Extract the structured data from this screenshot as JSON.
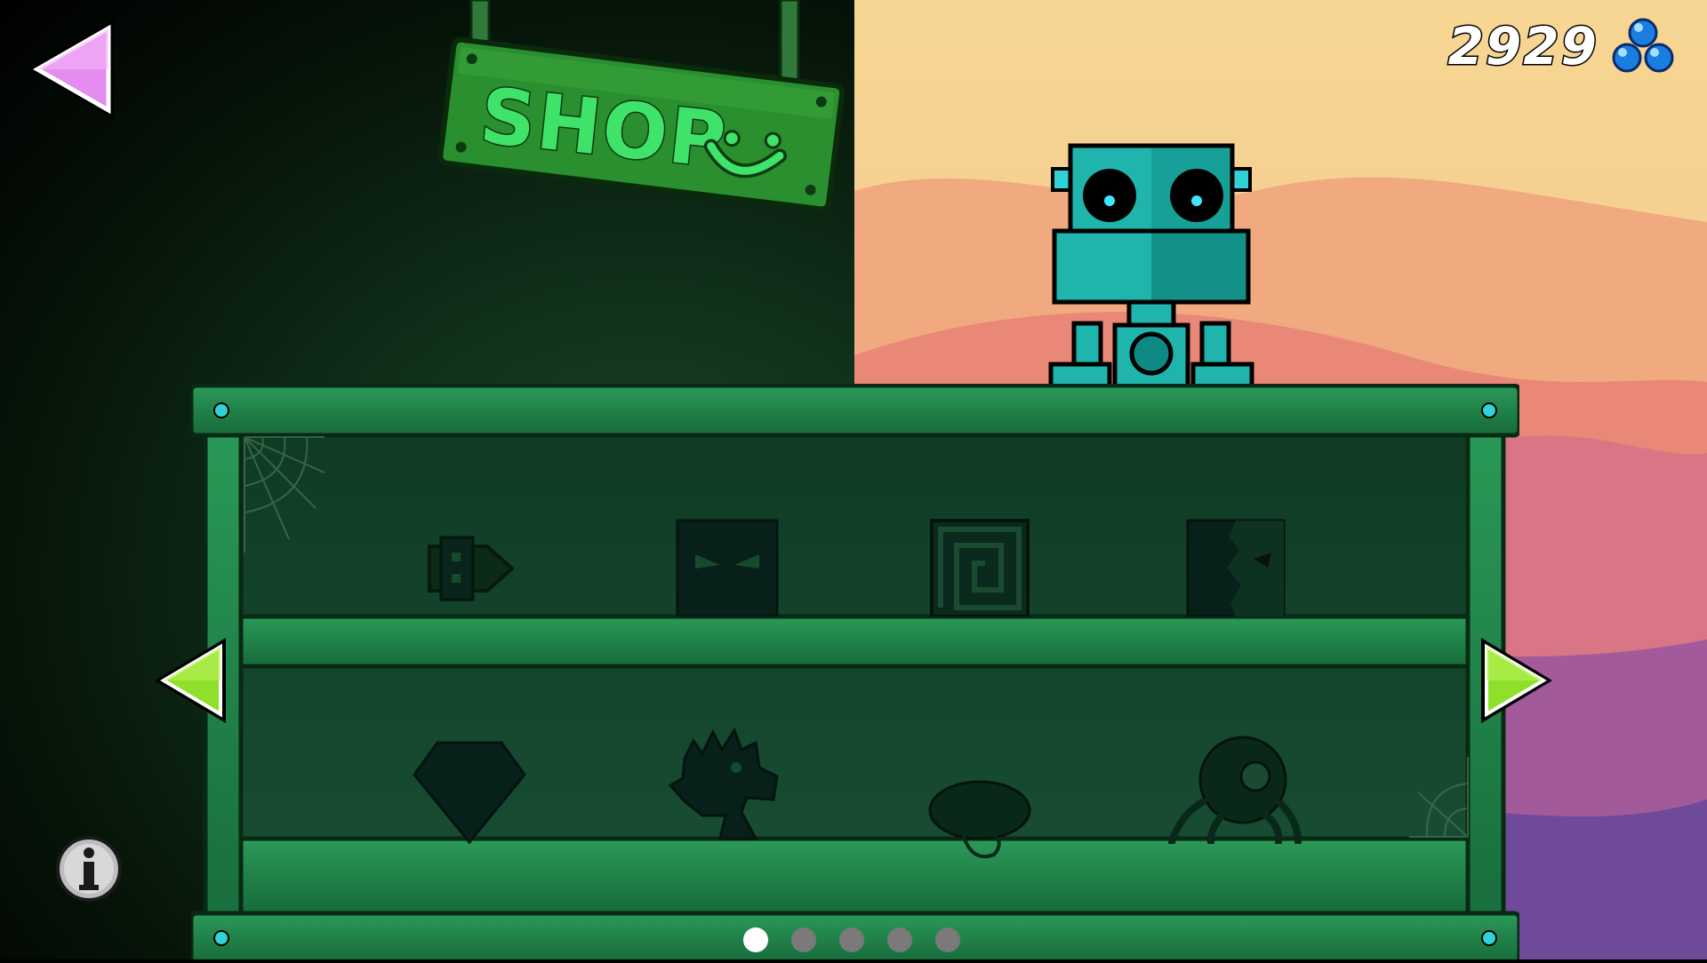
{
  "header": {
    "sign_text": "SHOP",
    "coin_count": "2929",
    "coin_icon": "blue-orbs-icon"
  },
  "navigation": {
    "back_icon": "back-arrow-icon",
    "prev_icon": "left-arrow-icon",
    "next_icon": "right-arrow-icon",
    "info_icon": "info-icon",
    "pages": [
      {
        "label": "1",
        "active": true
      },
      {
        "label": "2",
        "active": false
      },
      {
        "label": "3",
        "active": false
      },
      {
        "label": "4",
        "active": false
      },
      {
        "label": "5",
        "active": false
      }
    ]
  },
  "shop": {
    "top_row": [
      "locked-ship-icon",
      "locked-angry-cube-icon",
      "locked-spiral-cube-icon",
      "locked-torn-cube-icon"
    ],
    "bottom_row": [
      "locked-gem-icon",
      "locked-spiky-dragon-icon",
      "locked-tongue-creature-icon",
      "locked-eye-spider-icon"
    ]
  },
  "colors": {
    "accent_green": "#3fe36a",
    "shelf_green": "#1f7a44",
    "robot_teal": "#1fb5ad",
    "back_pink": "#e58cf0",
    "arrow_green": "#8ee02a"
  }
}
